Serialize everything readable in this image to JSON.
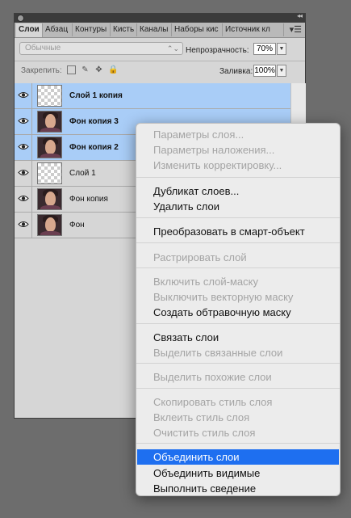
{
  "panel": {
    "tabs": [
      "Слои",
      "Абзац",
      "Контуры",
      "Кисть",
      "Каналы",
      "Наборы кис",
      "Источник кл"
    ],
    "blend_mode": "Обычные",
    "opacity_label": "Непрозрачность:",
    "opacity_value": "70%",
    "lock_label": "Закрепить:",
    "fill_label": "Заливка:",
    "fill_value": "100%"
  },
  "layers": [
    {
      "name": "Слой 1 копия",
      "selected": true,
      "thumb": "transparent"
    },
    {
      "name": "Фон копия 3",
      "selected": true,
      "thumb": "photo"
    },
    {
      "name": "Фон копия 2",
      "selected": true,
      "thumb": "photo"
    },
    {
      "name": "Слой 1",
      "selected": false,
      "thumb": "transparent"
    },
    {
      "name": "Фон копия",
      "selected": false,
      "thumb": "photo"
    },
    {
      "name": "Фон",
      "selected": false,
      "thumb": "photo"
    }
  ],
  "menu": {
    "items": [
      {
        "label": "Параметры слоя...",
        "enabled": false
      },
      {
        "label": "Параметры наложения...",
        "enabled": false
      },
      {
        "label": "Изменить корректировку...",
        "enabled": false
      },
      {
        "label": "Дубликат слоев...",
        "enabled": true
      },
      {
        "label": "Удалить слои",
        "enabled": true
      },
      {
        "label": "Преобразовать в смарт-объект",
        "enabled": true
      },
      {
        "label": "Растрировать слой",
        "enabled": false
      },
      {
        "label": "Включить слой-маску",
        "enabled": false
      },
      {
        "label": "Выключить векторную маску",
        "enabled": false
      },
      {
        "label": "Создать обтравочную маску",
        "enabled": true
      },
      {
        "label": "Связать слои",
        "enabled": true
      },
      {
        "label": "Выделить связанные слои",
        "enabled": false
      },
      {
        "label": "Выделить похожие слои",
        "enabled": false
      },
      {
        "label": "Скопировать стиль слоя",
        "enabled": false
      },
      {
        "label": "Вклеить стиль слоя",
        "enabled": false
      },
      {
        "label": "Очистить стиль слоя",
        "enabled": false
      },
      {
        "label": "Объединить слои",
        "enabled": true,
        "highlighted": true
      },
      {
        "label": "Объединить видимые",
        "enabled": true
      },
      {
        "label": "Выполнить сведение",
        "enabled": true
      }
    ]
  },
  "colors": {
    "selection": "#a9cdf7",
    "menu_highlight": "#1e6ff0"
  }
}
